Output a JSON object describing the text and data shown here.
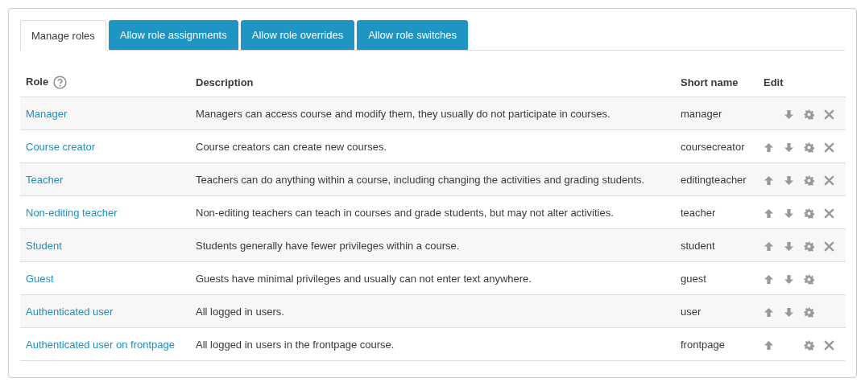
{
  "tabs": [
    {
      "label": "Manage roles",
      "selected": true
    },
    {
      "label": "Allow role assignments",
      "selected": false
    },
    {
      "label": "Allow role overrides",
      "selected": false
    },
    {
      "label": "Allow role switches",
      "selected": false
    }
  ],
  "table": {
    "columns": [
      "Role",
      "Description",
      "Short name",
      "Edit"
    ],
    "rows": [
      {
        "role": "Manager",
        "description": "Managers can access course and modify them, they usually do not participate in courses.",
        "short_name": "manager",
        "can_move_up": false,
        "can_move_down": true,
        "can_delete": true
      },
      {
        "role": "Course creator",
        "description": "Course creators can create new courses.",
        "short_name": "coursecreator",
        "can_move_up": true,
        "can_move_down": true,
        "can_delete": true
      },
      {
        "role": "Teacher",
        "description": "Teachers can do anything within a course, including changing the activities and grading students.",
        "short_name": "editingteacher",
        "can_move_up": true,
        "can_move_down": true,
        "can_delete": true
      },
      {
        "role": "Non-editing teacher",
        "description": "Non-editing teachers can teach in courses and grade students, but may not alter activities.",
        "short_name": "teacher",
        "can_move_up": true,
        "can_move_down": true,
        "can_delete": true
      },
      {
        "role": "Student",
        "description": "Students generally have fewer privileges within a course.",
        "short_name": "student",
        "can_move_up": true,
        "can_move_down": true,
        "can_delete": true
      },
      {
        "role": "Guest",
        "description": "Guests have minimal privileges and usually can not enter text anywhere.",
        "short_name": "guest",
        "can_move_up": true,
        "can_move_down": true,
        "can_delete": false
      },
      {
        "role": "Authenticated user",
        "description": "All logged in users.",
        "short_name": "user",
        "can_move_up": true,
        "can_move_down": true,
        "can_delete": false
      },
      {
        "role": "Authenticated user on frontpage",
        "description": "All logged in users in the frontpage course.",
        "short_name": "frontpage",
        "can_move_up": true,
        "can_move_down": false,
        "can_delete": true
      }
    ]
  }
}
